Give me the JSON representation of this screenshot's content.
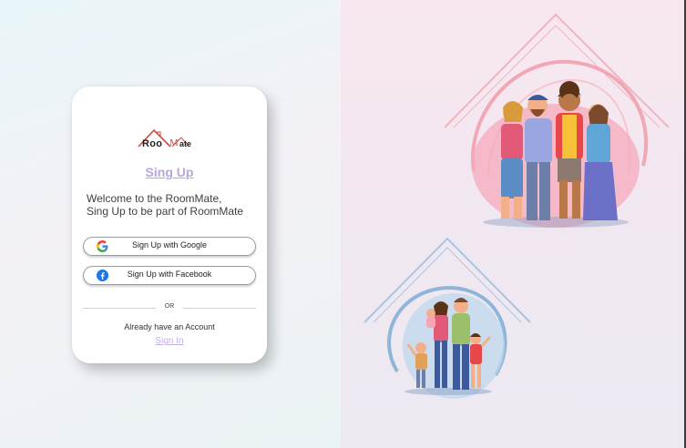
{
  "app": {
    "logo": {
      "part1": "Roo",
      "part2": "M",
      "part3": "ate"
    }
  },
  "card": {
    "title": "Sing Up",
    "welcome_line1": "Welcome to the RoomMate,",
    "welcome_line2": "Sing Up to be part of RoomMate",
    "google_label": "Sign Up with Google",
    "facebook_label": "Sign Up with Facebook",
    "or_label": "OR",
    "already_text": "Already have an Account",
    "signin_label": "Sign In"
  },
  "icons": [
    "google-icon",
    "facebook-icon"
  ],
  "colors": {
    "title": "#b7a4e0",
    "signin": "#c0aee5",
    "facebook": "#1877f2",
    "logo_red": "#d4463b"
  }
}
